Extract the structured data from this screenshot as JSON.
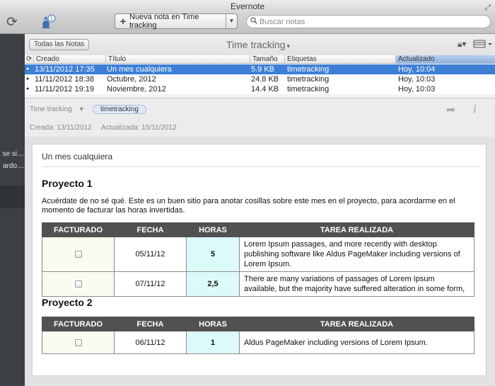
{
  "window": {
    "title": "Evernote"
  },
  "toolbar": {
    "new_note_label": "Nueva nota en Time tracking",
    "search_placeholder": "Buscar notas",
    "account_badge": "1"
  },
  "sidebar": {
    "stub1": "se si…",
    "stub2": "ardo…"
  },
  "notelist": {
    "all_notes_button": "Todas las Notas",
    "notebook_title": "Time tracking",
    "columns": {
      "created": "Creado",
      "title": "Título",
      "size": "Tamaño",
      "tags": "Etiquetas",
      "updated": "Actualizado"
    },
    "rows": [
      {
        "created": "13/11/2012 17:35",
        "title": "Un mes cualquiera",
        "size": "5.9 KB",
        "tags": "timetracking",
        "updated": "Hoy, 10:04",
        "selected": true
      },
      {
        "created": "11/11/2012 18:38",
        "title": "Octubre, 2012",
        "size": "24.8 KB",
        "tags": "timetracking",
        "updated": "Hoy, 10:03",
        "selected": false
      },
      {
        "created": "11/11/2012 19:19",
        "title": "Noviembre, 2012",
        "size": "14.4 KB",
        "tags": "timetracking",
        "updated": "Hoy, 10:03",
        "selected": false
      }
    ]
  },
  "note_meta": {
    "notebook": "Time tracking",
    "tag": "timetracking",
    "created": "Creada: 13/11/2012",
    "updated": "Actualizada: 15/11/2012"
  },
  "note": {
    "title": "Un mes cualquiera",
    "project1_heading": "Proyecto 1",
    "project1_text": "Acuérdate de no sé qué. Este es un buen sitio para anotar cosillas sobre este mes en el proyecto, para acordarme en el momento de facturar las horas invertidas.",
    "project2_heading": "Proyecto 2",
    "table_headers": {
      "billed": "FACTURADO",
      "date": "FECHA",
      "hours": "HORAS",
      "task": "TAREA REALIZADA"
    },
    "table1": [
      {
        "date": "05/11/12",
        "hours": "5",
        "task": "Lorem Ipsum passages, and more recently with desktop publishing software like Aldus PageMaker including versions of Lorem Ipsum."
      },
      {
        "date": "07/11/12",
        "hours": "2,5",
        "task": "There are many variations of passages of Lorem Ipsum available, but the majority have suffered alteration in some form,"
      }
    ],
    "table2": [
      {
        "date": "06/11/12",
        "hours": "1",
        "task": "Aldus PageMaker including versions of Lorem Ipsum."
      }
    ]
  },
  "colors": {
    "selection": "#3d7fd5",
    "table_header": "#515151",
    "hours_cell": "#dcfbf8",
    "billed_cell": "#fbfbf1",
    "sidebar": "#3c3f44"
  }
}
